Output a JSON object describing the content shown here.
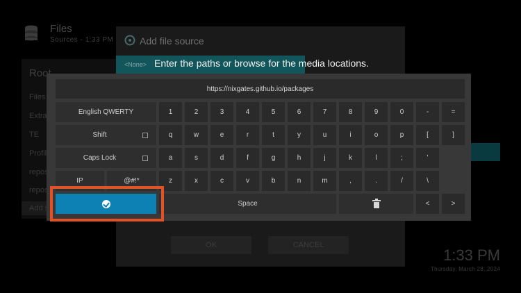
{
  "background": {
    "title": "Files",
    "subtitle": "Sources - 1:33 PM",
    "panel_title": "Root",
    "panel_items": [
      "Files",
      "Extra",
      "TE",
      "Profile",
      "reposi",
      "reposi",
      "Add s"
    ],
    "clock": "1:33 PM",
    "date": "Thursday, March 28, 2024"
  },
  "dialog": {
    "title": "Add file source",
    "field_value": "<None>",
    "hint": "Enter the paths or browse for the media locations.",
    "ok_label": "OK",
    "cancel_label": "CANCEL"
  },
  "keyboard": {
    "input_value": "https://nixgates.github.io/packages",
    "layout_label": "English QWERTY",
    "shift_label": "Shift",
    "caps_label": "Caps Lock",
    "ip_label": "IP",
    "symbols_label": "@#!*",
    "space_label": "Space",
    "left_label": "<",
    "right_label": ">",
    "row1": [
      "1",
      "2",
      "3",
      "4",
      "5",
      "6",
      "7",
      "8",
      "9",
      "0",
      "-",
      "="
    ],
    "row2": [
      "q",
      "w",
      "e",
      "r",
      "t",
      "y",
      "u",
      "i",
      "o",
      "p",
      "[",
      "]"
    ],
    "row3": [
      "a",
      "s",
      "d",
      "f",
      "g",
      "h",
      "j",
      "k",
      "l",
      ";",
      "'"
    ],
    "row4": [
      "z",
      "x",
      "c",
      "v",
      "b",
      "n",
      "m",
      ",",
      ".",
      "/",
      "\\"
    ]
  },
  "colors": {
    "done_key": "#0d81b4",
    "highlight_outline": "#e35226",
    "dialog_field": "#12565b"
  },
  "icons": {
    "done": "checkmark-circle-icon",
    "backspace": "trash-icon",
    "shift": "checkbox-icon",
    "caps": "checkbox-icon",
    "source": "source-icon",
    "files": "database-icon"
  }
}
